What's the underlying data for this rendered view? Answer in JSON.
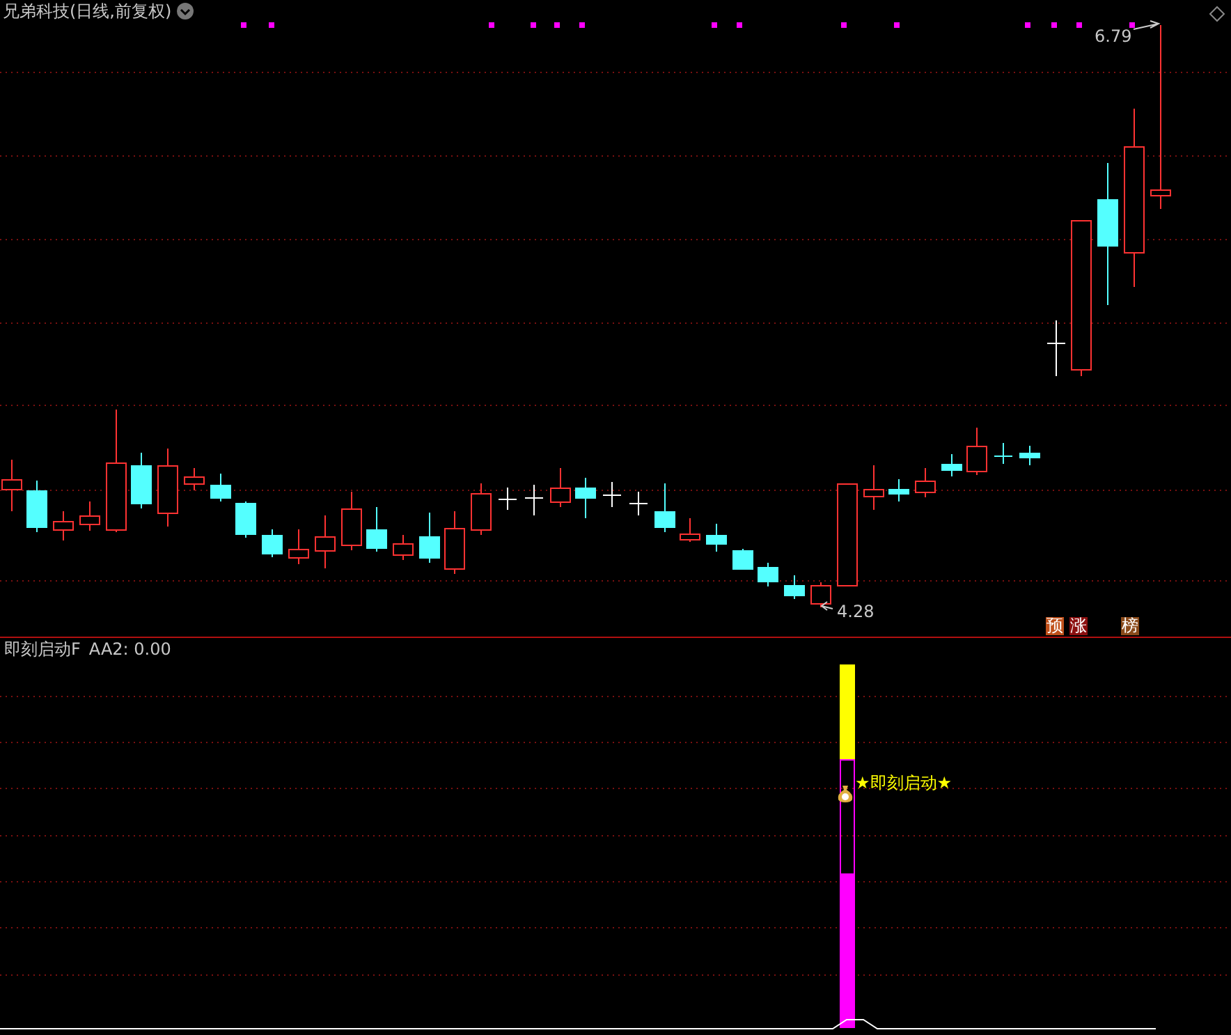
{
  "header": {
    "title": "兄弟科技(日线,前复权)"
  },
  "price_chart": {
    "high_label": "6.79",
    "low_label": "4.28",
    "badges": [
      {
        "text": "预",
        "color": "#c0501a"
      },
      {
        "text": "涨",
        "color": "#8b0f0f"
      },
      {
        "text": "榜",
        "color": "#8a4a1a"
      }
    ]
  },
  "indicator": {
    "title": "即刻启动F",
    "reading": "AA2: 0.00",
    "signal_label": "★即刻启动★"
  }
}
